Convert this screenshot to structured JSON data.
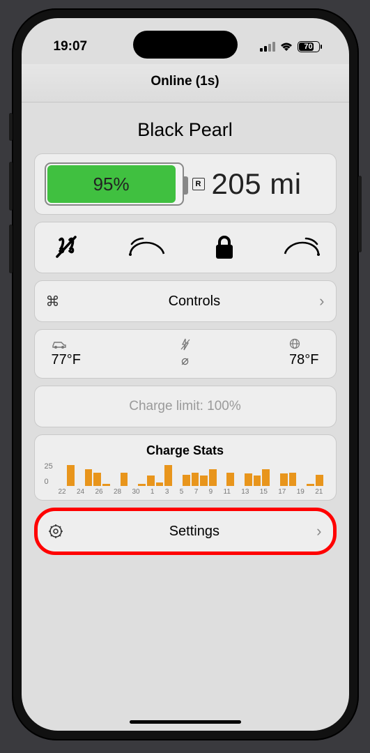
{
  "status_bar": {
    "time": "19:07",
    "battery_pct": "70"
  },
  "header": {
    "status": "Online (1s)"
  },
  "vehicle": {
    "name": "Black Pearl"
  },
  "battery": {
    "pct": "95%",
    "range_label": "205 mi",
    "rated_badge": "R"
  },
  "rows": {
    "controls_label": "Controls",
    "settings_label": "Settings"
  },
  "temps": {
    "interior": "77°F",
    "center": "⌀",
    "exterior": "78°F"
  },
  "charge_limit": {
    "text": "Charge limit: 100%"
  },
  "chart_data": {
    "type": "bar",
    "title": "Charge Stats",
    "ylabel": "",
    "ylim": [
      0,
      25
    ],
    "yticks": [
      0,
      25
    ],
    "categories": [
      22,
      23,
      24,
      25,
      26,
      27,
      28,
      29,
      30,
      1,
      2,
      3,
      4,
      5,
      6,
      7,
      8,
      9,
      10,
      11,
      12,
      13,
      14,
      15,
      16,
      17,
      18,
      19,
      20,
      21
    ],
    "xticks": [
      22,
      24,
      26,
      28,
      30,
      1,
      3,
      5,
      7,
      9,
      11,
      13,
      15,
      17,
      19,
      21
    ],
    "values": [
      0,
      22,
      0,
      18,
      14,
      2,
      0,
      14,
      0,
      2,
      11,
      4,
      22,
      0,
      12,
      14,
      11,
      18,
      0,
      14,
      0,
      13,
      11,
      18,
      0,
      13,
      14,
      0,
      2,
      12
    ]
  }
}
